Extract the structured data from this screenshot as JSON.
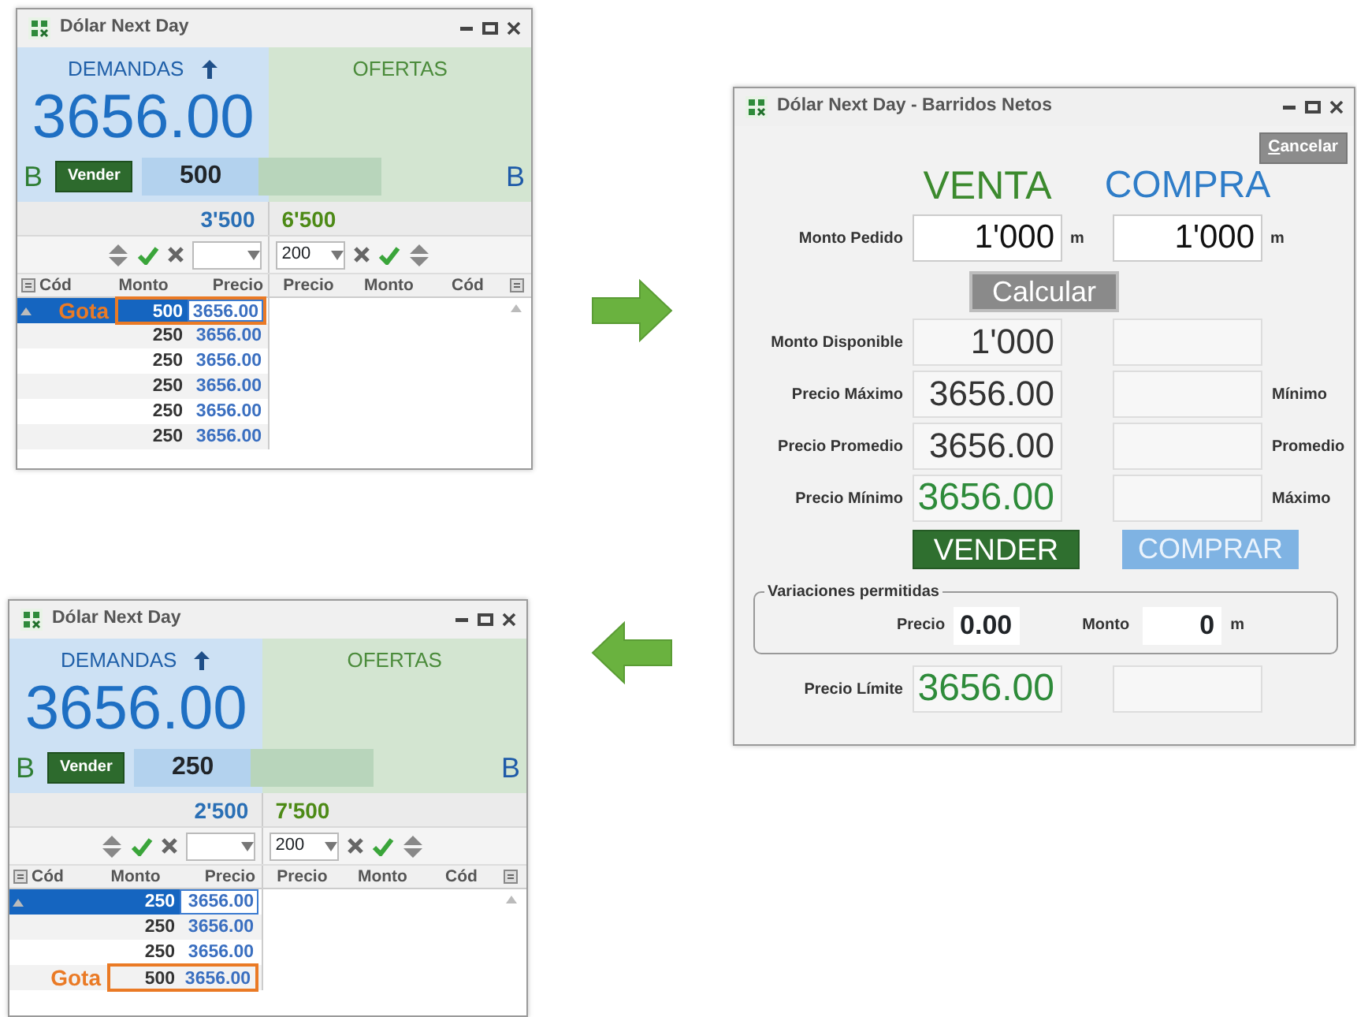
{
  "panels": [
    {
      "title": "Dólar Next Day",
      "bid_heading": "DEMANDAS",
      "ask_heading": "OFERTAS",
      "price": "3656.00",
      "bid_side": "B",
      "sell_button": "Vender",
      "quantity": "500",
      "ask_side": "B",
      "bid_total": "3'500",
      "ask_total": "6'500",
      "ask_select": "200",
      "columns": [
        "Cód",
        "Monto",
        "Precio",
        "Precio",
        "Monto",
        "Cód"
      ],
      "rows": [
        {
          "annotation": "Gota",
          "monto": "500",
          "precio": "3656.00",
          "selected": true,
          "highlighted": true
        },
        {
          "monto": "250",
          "precio": "3656.00",
          "selected": false,
          "highlighted": false
        },
        {
          "monto": "250",
          "precio": "3656.00",
          "selected": false,
          "highlighted": false
        },
        {
          "monto": "250",
          "precio": "3656.00",
          "selected": false,
          "highlighted": false
        },
        {
          "monto": "250",
          "precio": "3656.00",
          "selected": false,
          "highlighted": false
        },
        {
          "monto": "250",
          "precio": "3656.00",
          "selected": false,
          "highlighted": false
        }
      ]
    },
    {
      "title": "Dólar Next Day",
      "bid_heading": "DEMANDAS",
      "ask_heading": "OFERTAS",
      "price": "3656.00",
      "bid_side": "B",
      "sell_button": "Vender",
      "quantity": "250",
      "ask_side": "B",
      "bid_total": "2'500",
      "ask_total": "7'500",
      "ask_select": "200",
      "columns": [
        "Cód",
        "Monto",
        "Precio",
        "Precio",
        "Monto",
        "Cód"
      ],
      "rows": [
        {
          "monto": "250",
          "precio": "3656.00",
          "selected": true,
          "highlighted": false
        },
        {
          "monto": "250",
          "precio": "3656.00",
          "selected": false,
          "highlighted": false
        },
        {
          "monto": "250",
          "precio": "3656.00",
          "selected": false,
          "highlighted": false
        },
        {
          "annotation": "Gota",
          "monto": "500",
          "precio": "3656.00",
          "selected": false,
          "highlighted": true
        }
      ]
    }
  ],
  "dialog": {
    "title": "Dólar Next Day - Barridos Netos",
    "cancel_button": "Cancelar",
    "venta_heading": "VENTA",
    "compra_heading": "COMPRA",
    "request": {
      "label": "Monto Pedido",
      "venta": "1'000",
      "compra": "1'000",
      "venta_unit": "m",
      "compra_unit": "m"
    },
    "calculate_button": "Calcular",
    "rows": [
      {
        "label": "Monto Disponible",
        "venta": "1'000",
        "kind": "readout"
      },
      {
        "label": "Precio Máximo",
        "venta": "3656.00",
        "right_label": "Mínimo",
        "kind": "readout"
      },
      {
        "label": "Precio Promedio",
        "venta": "3656.00",
        "right_label": "Promedio",
        "kind": "readout"
      },
      {
        "label": "Precio Mínimo",
        "venta": "3656.00",
        "right_label": "Máximo",
        "kind": "result"
      }
    ],
    "sell_button": "VENDER",
    "buy_button": "COMPRAR",
    "variations": {
      "legend": "Variaciones permitidas",
      "price_label": "Precio",
      "price": "0.00",
      "amount_label": "Monto",
      "amount": "0",
      "unit": "m"
    },
    "limit": {
      "label": "Precio Límite",
      "venta": "3656.00",
      "kind": "result"
    }
  },
  "arrows": [
    {
      "kind": "right"
    },
    {
      "kind": "left"
    }
  ]
}
